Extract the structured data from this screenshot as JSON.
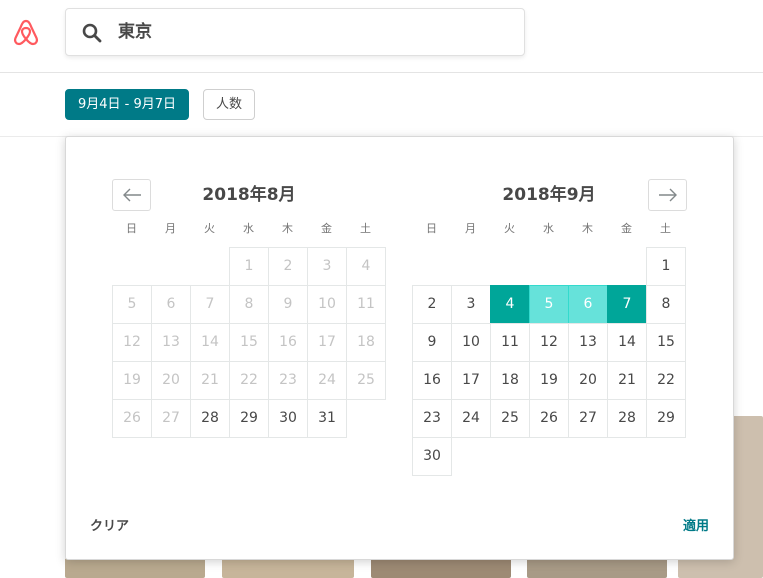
{
  "header": {
    "logo_name": "airbnb-logo",
    "search": {
      "value": "東京",
      "icon": "search-icon"
    }
  },
  "filters": {
    "dates_label": "9月4日 - 9月7日",
    "guests_label": "人数"
  },
  "colors": {
    "teal_dark": "#007a87",
    "selected_end": "#00a699",
    "selected_span": "#66e2da",
    "logo_red": "#ff5a5f"
  },
  "calendar": {
    "weekdays": [
      "日",
      "月",
      "火",
      "水",
      "木",
      "金",
      "土"
    ],
    "months": [
      {
        "title": "2018年8月",
        "first_weekday_index": 3,
        "days": 31,
        "past_until": 27,
        "selected_start": null,
        "selected_end": null
      },
      {
        "title": "2018年9月",
        "first_weekday_index": 6,
        "days": 30,
        "past_until": 0,
        "selected_start": 4,
        "selected_end": 7
      }
    ],
    "prev_icon": "arrow-left-icon",
    "next_icon": "arrow-right-icon",
    "clear_label": "クリア",
    "apply_label": "適用"
  }
}
